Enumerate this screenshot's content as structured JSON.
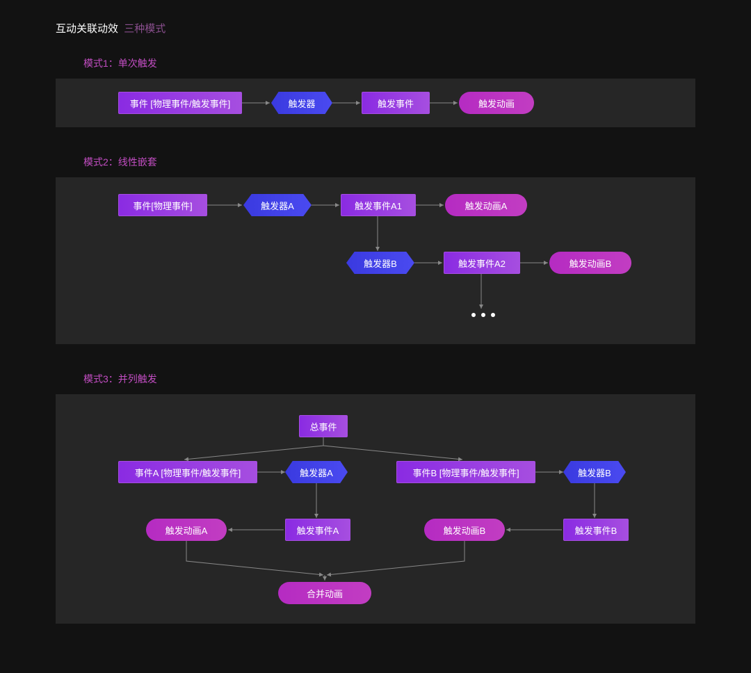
{
  "header": {
    "main": "互动关联动效",
    "sub": "三种模式"
  },
  "mode1": {
    "title": "模式1：单次触发",
    "n_event": "事件 [物理事件/触发事件]",
    "n_trigger": "触发器",
    "n_trigevent": "触发事件",
    "n_anim": "触发动画"
  },
  "mode2": {
    "title": "模式2：线性嵌套",
    "n_event": "事件[物理事件]",
    "n_triggerA": "触发器A",
    "n_trigeventA1": "触发事件A1",
    "n_animA": "触发动画A",
    "n_triggerB": "触发器B",
    "n_trigeventA2": "触发事件A2",
    "n_animB": "触发动画B"
  },
  "mode3": {
    "title": "模式3：并列触发",
    "n_root": "总事件",
    "n_eventA": "事件A [物理事件/触发事件]",
    "n_triggerA": "触发器A",
    "n_trigeventA": "触发事件A",
    "n_animA": "触发动画A",
    "n_eventB": "事件B [物理事件/触发事件]",
    "n_triggerB": "触发器B",
    "n_trigeventB": "触发事件B",
    "n_animB": "触发动画B",
    "n_merge": "合并动画"
  }
}
